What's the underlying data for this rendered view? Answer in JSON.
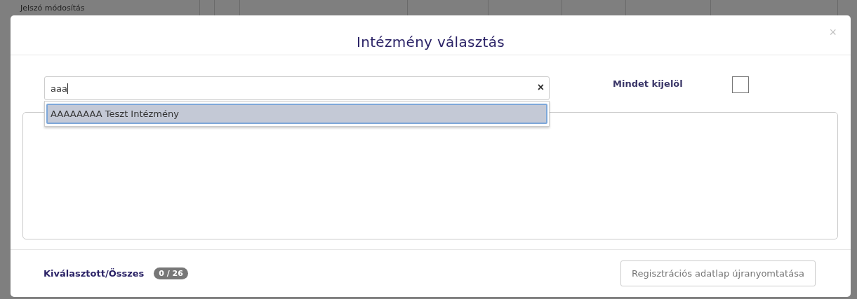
{
  "background": {
    "menu_item": "Jelszó módosítás"
  },
  "dialog": {
    "title": "Intézmény választás",
    "close": "×",
    "search": {
      "value": "aaa",
      "clear": "×",
      "suggestions": [
        {
          "label": "AAAAAAAA Teszt Intézmény",
          "selected": true
        }
      ]
    },
    "select_all": {
      "label": "Mindet kijelöl",
      "checked": false
    },
    "footer": {
      "label": "Kiválasztott/Összes",
      "count": "0 / 26",
      "button": {
        "label": "Regisztrációs adatlap újranyomtatása",
        "disabled": true
      }
    }
  }
}
